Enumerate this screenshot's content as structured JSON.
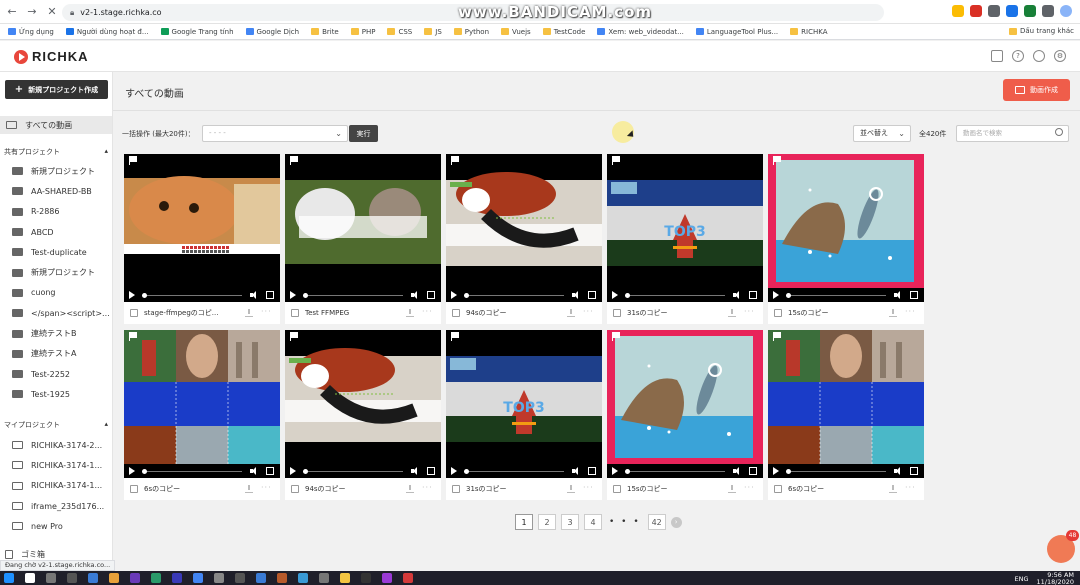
{
  "browser": {
    "url": "v2-1.stage.richka.co",
    "watermark": "www.BANDICAM.com",
    "bookmarks": [
      "Ứng dụng",
      "Người dùng hoạt đ...",
      "Google Trang tính",
      "Google Dịch",
      "Brite",
      "PHP",
      "CSS",
      "JS",
      "Python",
      "Vuejs",
      "TestCode",
      "Xem: web_videodat...",
      "LanguageTool Plus...",
      "RICHKA"
    ],
    "bookmark_right": "Dấu trang khác",
    "status_text": "Đang chờ v2-1.stage.richka.co..."
  },
  "app": {
    "logo": "RICHKA",
    "new_project_label": "新規プロジェクト作成",
    "all_videos_label": "すべての動画",
    "shared_section": "共有プロジェクト",
    "shared_items": [
      "新規プロジェクト",
      "AA-SHARED-BB",
      "R-2886",
      "ABCD",
      "Test-duplicate",
      "新規プロジェクト",
      "cuong",
      "</span><script>...",
      "連続テストB",
      "連続テストA",
      "Test-2252",
      "Test-1925"
    ],
    "my_section": "マイプロジェクト",
    "my_items": [
      "RICHIKA-3174-2...",
      "RICHIKA-3174-1...",
      "RICHIKA-3174-1...",
      "iframe_235d176...",
      "new Pro"
    ],
    "trash_label": "ゴミ箱"
  },
  "main": {
    "title": "すべての動画",
    "create_label": "動画作成",
    "bulk_label": "一括操作 (最大20件)：",
    "bulk_placeholder": "- - - -",
    "exec_label": "実行",
    "sort_label": "並べ替え",
    "total_label": "全420件",
    "search_placeholder": "動画名で検索"
  },
  "videos": [
    {
      "name": "stage-ffmpegのコピ...",
      "thumb": "cat"
    },
    {
      "name": "Test FFMPEG",
      "thumb": "cats"
    },
    {
      "name": "94sのコピー",
      "thumb": "panda"
    },
    {
      "name": "31sのコピー",
      "thumb": "top3"
    },
    {
      "name": "15sのコピー",
      "thumb": "dolphin"
    },
    {
      "name": "6sのコピー",
      "thumb": "collage"
    },
    {
      "name": "94sのコピー",
      "thumb": "panda"
    },
    {
      "name": "31sのコピー",
      "thumb": "top3"
    },
    {
      "name": "15sのコピー",
      "thumb": "dolphin"
    },
    {
      "name": "6sのコピー",
      "thumb": "collage"
    }
  ],
  "overlay_text": "TOP3",
  "pagination": {
    "pages": [
      "1",
      "2",
      "3",
      "4"
    ],
    "last": "42",
    "current": "1",
    "ellipsis": "• • •"
  },
  "chat_badge": "48",
  "taskbar": {
    "lang": "ENG",
    "time": "9:56 AM",
    "date": "11/18/2020"
  },
  "colors": {
    "accent": "#ef5d4a",
    "dark_button": "#333333",
    "dolphin_frame": "#e8245a"
  }
}
